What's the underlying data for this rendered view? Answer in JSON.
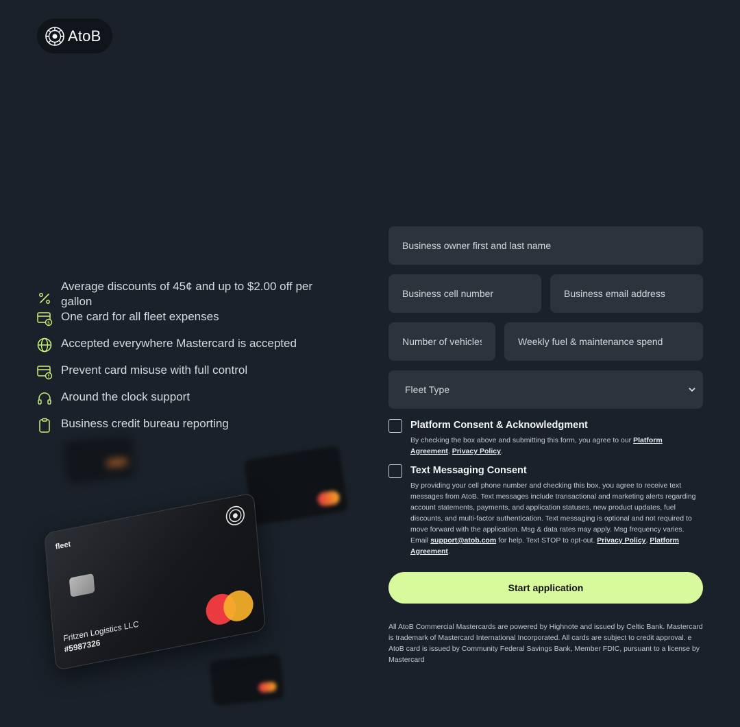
{
  "brand": {
    "name": "AtoB"
  },
  "features": [
    {
      "icon": "percent-icon",
      "text": "Average discounts of 45¢ and up to $2.00 off per gallon"
    },
    {
      "icon": "card-dollar-icon",
      "text": "One card for all fleet expenses"
    },
    {
      "icon": "globe-icon",
      "text": "Accepted everywhere Mastercard is accepted"
    },
    {
      "icon": "card-alert-icon",
      "text": "Prevent card misuse with full control"
    },
    {
      "icon": "headset-icon",
      "text": "Around the clock support"
    },
    {
      "icon": "clipboard-icon",
      "text": "Business credit bureau reporting"
    }
  ],
  "card": {
    "label": "fleet",
    "holder": "Fritzen Logistics LLC",
    "number": "#5987326"
  },
  "form": {
    "name_placeholder": "Business owner first and last name",
    "phone_placeholder": "Business cell number",
    "email_placeholder": "Business email address",
    "vehicles_placeholder": "Number of vehicles",
    "spend_placeholder": "Weekly fuel & maintenance spend",
    "fleet_type": "Fleet Type",
    "platform_consent": {
      "title": "Platform Consent & Acknowledgment",
      "body": "By checking the box above and submitting this form, you agree to our",
      "link1": "Platform Agreement",
      "sep": ",",
      "link2": "Privacy Policy",
      "end": "."
    },
    "sms_consent": {
      "title": "Text Messaging Consent",
      "body": "By providing your cell phone number and checking this box, you agree to receive text messages from AtoB. Text messages include transactional and marketing alerts regarding account statements, payments, and application statuses, new product updates, fuel discounts, and multi-factor authentication. Text messaging is optional and not required to move forward with the application. Msg & data rates may apply. Msg frequency varies. Email",
      "email_link": "support@atob.com",
      "body2": "for help. Text STOP to opt-out.",
      "link1": "Privacy Policy",
      "sep": ",",
      "link2": "Platform Agreement",
      "end": "."
    },
    "submit_label": "Start application",
    "disclaimer": "All AtoB Commercial Mastercards are powered by Highnote and issued by Celtic Bank. Mastercard is trademark of Mastercard International Incorporated. All cards are subject to credit approval. e AtoB card is issued by Community Federal Savings Bank, Member FDIC, pursuant to a license by Mastercard"
  }
}
